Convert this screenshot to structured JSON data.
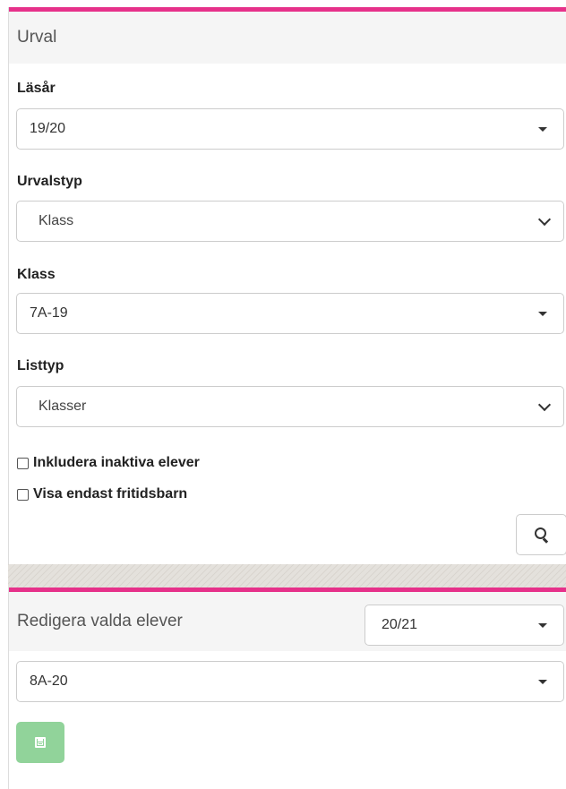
{
  "selection_panel": {
    "title": "Urval",
    "school_year": {
      "label": "Läsår",
      "value": "19/20"
    },
    "selection_type": {
      "label": "Urvalstyp",
      "value": "Klass"
    },
    "class": {
      "label": "Klass",
      "value": "7A-19"
    },
    "list_type": {
      "label": "Listtyp",
      "value": "Klasser"
    },
    "checkboxes": [
      {
        "label": "Inkludera inaktiva elever",
        "checked": false
      },
      {
        "label": "Visa endast fritidsbarn",
        "checked": false
      }
    ],
    "search_icon": "search-icon"
  },
  "edit_panel": {
    "title": "Redigera valda elever",
    "school_year_value": "20/21",
    "class_value": "8A-20",
    "save_icon": "floppy-disk-icon"
  },
  "colors": {
    "accent": "#e6318a",
    "save_button": "#91d39a",
    "heading_bg": "#f5f5f5"
  }
}
